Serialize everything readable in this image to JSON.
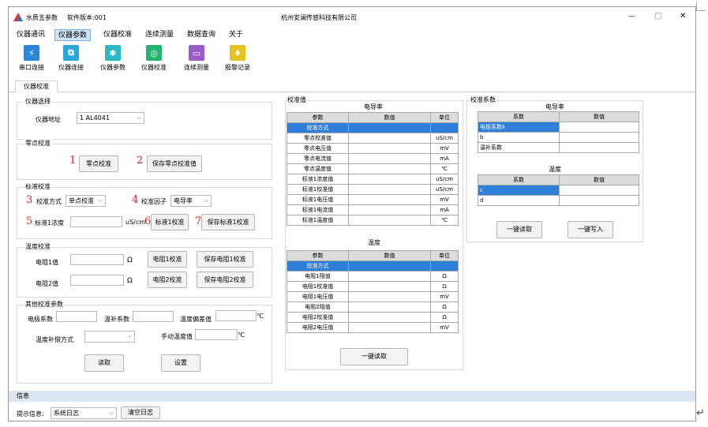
{
  "window": {
    "app_name": "水质五参数",
    "version": "软件版本:001",
    "company": "杭州安澜传感科技有限公司",
    "minimize": "—",
    "maximize": "□",
    "close": "✕"
  },
  "menu": [
    "仪器通讯",
    "仪器参数",
    "仪器校准",
    "连续测量",
    "数据查询",
    "关于"
  ],
  "toolbar": [
    {
      "label": "串口连接",
      "icon": "plug-icon",
      "color": "#2a86d8"
    },
    {
      "label": "仪器连接",
      "icon": "link-icon",
      "color": "#29a7d9"
    },
    {
      "label": "仪器参数",
      "icon": "gear-icon",
      "color": "#2bbac1"
    },
    {
      "label": "仪器校准",
      "icon": "target-icon",
      "color": "#22b46e"
    },
    {
      "label": "连续测量",
      "icon": "monitor-icon",
      "color": "#9a5bc9"
    },
    {
      "label": "报警记录",
      "icon": "alarm-icon",
      "color": "#e8c21e"
    }
  ],
  "tab": "仪器校准",
  "device_select": {
    "group_title": "仪器选择",
    "address_label": "仪器地址",
    "address_value": "1 AL4041"
  },
  "zero_cal": {
    "group_title": "零点校准",
    "btn_zero": "零点校准",
    "btn_save_zero": "保存零点校准值",
    "n1": "1",
    "n2": "2"
  },
  "std_cal": {
    "group_title": "标液校准",
    "method_label": "校准方式",
    "method_value": "单点校准",
    "factor_label": "校准因子",
    "factor_value": "电导率",
    "conc_label": "标液1浓度",
    "conc_unit": "uS/cm",
    "btn_cal1": "标液1校准",
    "btn_save1": "保存标液1校准",
    "n3": "3",
    "n4": "4",
    "n5": "5",
    "n6": "6",
    "n7": "7"
  },
  "temp_cal": {
    "group_title": "温度校准",
    "r1_label": "电阻1值",
    "r2_label": "电阻2值",
    "ohm": "Ω",
    "btn_r1": "电阻1校准",
    "btn_save_r1": "保存电阻1校准",
    "btn_r2": "电阻2校准",
    "btn_save_r2": "保存电阻2校准"
  },
  "other_params": {
    "group_title": "其他校准参数",
    "electrode_label": "电极系数",
    "temp_comp_label": "温补系数",
    "temp_offset_label": "温度偏差值",
    "temp_unit": "℃",
    "comp_method_label": "温度补偿方式",
    "manual_temp_label": "手动温度值",
    "btn_read": "读取",
    "btn_set": "设置"
  },
  "cal_values": {
    "group_title": "校准值",
    "cond_title": "电导率",
    "headers": [
      "参数",
      "数值",
      "单位"
    ],
    "cond_rows": [
      {
        "name": "校准方式",
        "value": "",
        "unit": ""
      },
      {
        "name": "零点校准值",
        "value": "",
        "unit": "uS/cm"
      },
      {
        "name": "零点电压值",
        "value": "",
        "unit": "mV"
      },
      {
        "name": "零点电流值",
        "value": "",
        "unit": "mA"
      },
      {
        "name": "零点温度值",
        "value": "",
        "unit": "℃"
      },
      {
        "name": "标液1浓度值",
        "value": "",
        "unit": "uS/cm"
      },
      {
        "name": "标液1校准值",
        "value": "",
        "unit": "uS/cm"
      },
      {
        "name": "标液1电压值",
        "value": "",
        "unit": "mV"
      },
      {
        "name": "标液1电流值",
        "value": "",
        "unit": "mA"
      },
      {
        "name": "标液1温度值",
        "value": "",
        "unit": "℃"
      }
    ],
    "temp_title": "温度",
    "temp_rows": [
      {
        "name": "校准方式",
        "value": "",
        "unit": ""
      },
      {
        "name": "电阻1阻值",
        "value": "",
        "unit": "Ω"
      },
      {
        "name": "电阻1校准值",
        "value": "",
        "unit": "Ω"
      },
      {
        "name": "电阻1电压值",
        "value": "",
        "unit": "mV"
      },
      {
        "name": "电阻2阻值",
        "value": "",
        "unit": "Ω"
      },
      {
        "name": "电阻2校准值",
        "value": "",
        "unit": "Ω"
      },
      {
        "name": "电阻2电压值",
        "value": "",
        "unit": "mV"
      }
    ],
    "btn_read": "一键读取"
  },
  "coefficients": {
    "group_title": "校准系数",
    "cond_title": "电导率",
    "headers": [
      "系数",
      "数值"
    ],
    "cond_rows": [
      {
        "name": "电极系数k",
        "value": ""
      },
      {
        "name": "b",
        "value": ""
      },
      {
        "name": "温补系数",
        "value": ""
      }
    ],
    "temp_title": "温度",
    "temp_rows": [
      {
        "name": "c",
        "value": ""
      },
      {
        "name": "d",
        "value": ""
      }
    ],
    "btn_read": "一键读取",
    "btn_write": "一键写入"
  },
  "info": {
    "title": "信息",
    "prompt_label": "提示信息:",
    "log_value": "系统日志",
    "btn_clear": "清空日志"
  }
}
